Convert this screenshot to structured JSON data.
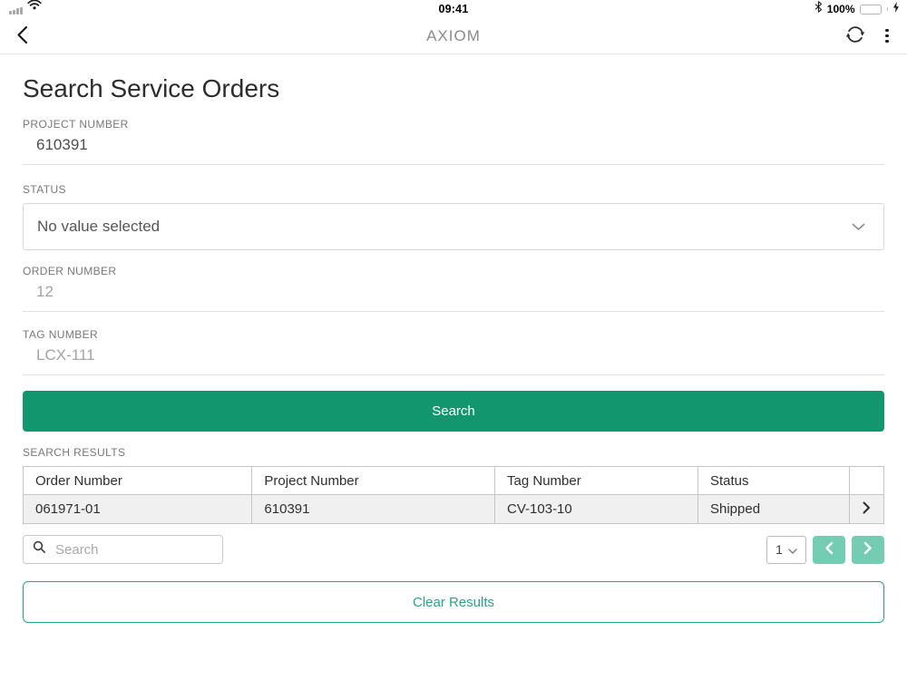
{
  "status_bar": {
    "time": "09:41",
    "battery_level": "100%",
    "icons": {
      "signal": "cellular-signal-icon",
      "wifi": "wifi-icon",
      "bluetooth": "bluetooth-icon",
      "battery": "battery-icon",
      "charging": "charging-bolt-icon"
    }
  },
  "header": {
    "title": "AXIOM",
    "icons": {
      "back": "back-chevron-icon",
      "sync": "sync-icon",
      "menu": "kebab-menu-icon"
    }
  },
  "page": {
    "title": "Search Service Orders"
  },
  "fields": {
    "project_number": {
      "label": "PROJECT NUMBER",
      "value": "610391"
    },
    "status": {
      "label": "STATUS",
      "selected": "No value selected"
    },
    "order_number": {
      "label": "ORDER NUMBER",
      "placeholder": "12"
    },
    "tag_number": {
      "label": "TAG NUMBER",
      "placeholder": "LCX-111"
    }
  },
  "actions": {
    "search_label": "Search",
    "clear_label": "Clear Results"
  },
  "results": {
    "section_label": "SEARCH RESULTS",
    "table": {
      "headers": [
        "Order Number",
        "Project Number",
        "Tag Number",
        "Status"
      ],
      "rows": [
        {
          "order_number": "061971-01",
          "project_number": "610391",
          "tag_number": "CV-103-10",
          "status": "Shipped"
        }
      ]
    },
    "filter_placeholder": "Search",
    "pager": {
      "page": "1"
    }
  },
  "colors": {
    "primary_green": "#12966e",
    "pager_green": "#74ccb3",
    "outline_green": "#2aa287",
    "battery_green": "#57d563",
    "header_title_gray": "#8b8b8b"
  }
}
